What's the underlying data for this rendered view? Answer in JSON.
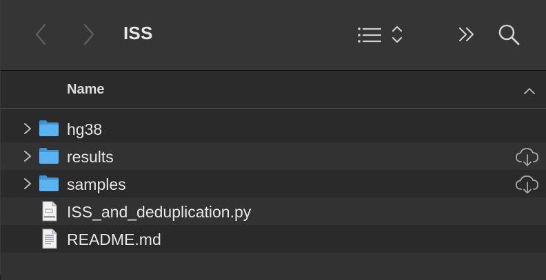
{
  "window": {
    "title": "ISS"
  },
  "toolbar": {
    "back_icon": "chevron-left-icon",
    "forward_icon": "chevron-right-icon",
    "view_icon": "list-view-icon",
    "more_icon": "double-chevron-right-icon",
    "search_icon": "magnifier-icon"
  },
  "header": {
    "name_column": "Name",
    "sort_icon": "chevron-up-icon"
  },
  "files": [
    {
      "name": "hg38",
      "kind": "folder",
      "expandable": true,
      "cloud": false
    },
    {
      "name": "results",
      "kind": "folder",
      "expandable": true,
      "cloud": true
    },
    {
      "name": "samples",
      "kind": "folder",
      "expandable": true,
      "cloud": true
    },
    {
      "name": "ISS_and_deduplication.py",
      "kind": "python-file",
      "expandable": false,
      "cloud": false
    },
    {
      "name": "README.md",
      "kind": "markdown-file",
      "expandable": false,
      "cloud": false
    }
  ],
  "colors": {
    "folder": "#5ab4f0",
    "background": "#2a2a2a",
    "toolbar": "#353535",
    "row_alt": "#323232"
  }
}
